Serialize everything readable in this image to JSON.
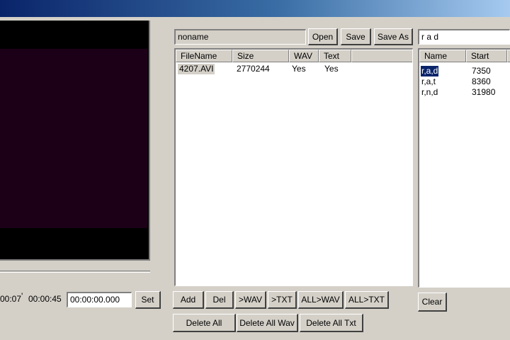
{
  "window": {
    "title": ""
  },
  "player": {
    "time_current": "00:07",
    "time_separator": "'",
    "time_total": "00:00:45",
    "set_time_value": "00:00:00.000",
    "set_label": "Set"
  },
  "project": {
    "name_value": "noname",
    "open_label": "Open",
    "save_label": "Save",
    "save_as_label": "Save As"
  },
  "file_table": {
    "columns": [
      "FileName",
      "Size",
      "WAV",
      "Text"
    ],
    "rows": [
      {
        "filename": "4207.AVI",
        "size": "2770244",
        "wav": "Yes",
        "text": "Yes"
      }
    ]
  },
  "file_actions": {
    "add": "Add",
    "del": "Del",
    "to_wav": ">WAV",
    "to_txt": ">TXT",
    "all_to_wav": "ALL>WAV",
    "all_to_txt": "ALL>TXT",
    "delete_all": "Delete All",
    "delete_all_wav": "Delete All Wav",
    "delete_all_txt": "Delete All Txt"
  },
  "search": {
    "value": "r a d",
    "clear_label": "Clear"
  },
  "results_table": {
    "columns": [
      "Name",
      "Start"
    ],
    "rows": [
      {
        "name": "r,a,d",
        "start": "7350",
        "selected": true
      },
      {
        "name": "r,a,t",
        "start": "8360",
        "selected": false
      },
      {
        "name": "r,n,d",
        "start": "31980",
        "selected": false
      }
    ]
  },
  "colors": {
    "face": "#d4d0c8",
    "selection": "#0a246a",
    "video_bg": "#1c0018"
  }
}
